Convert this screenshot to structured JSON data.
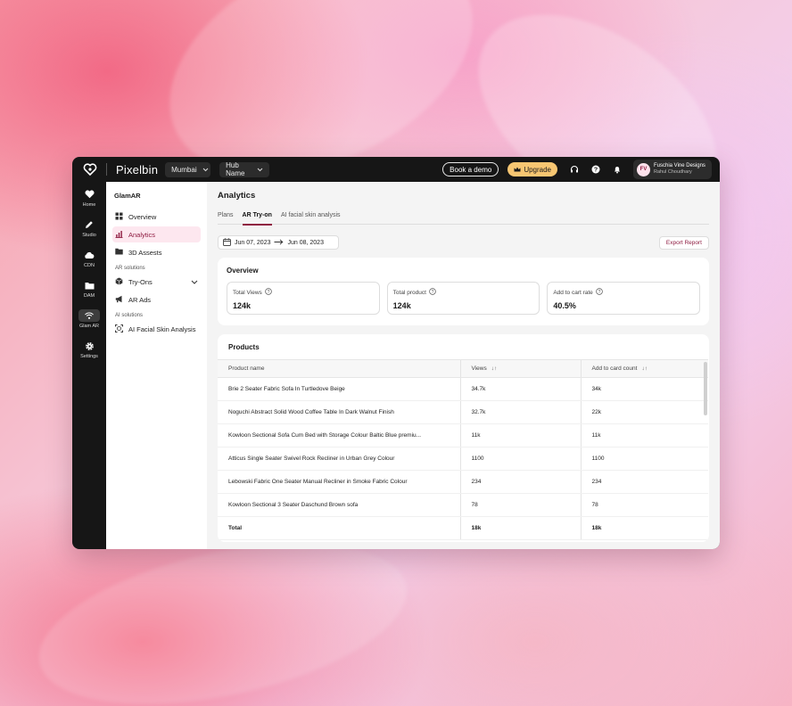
{
  "colors": {
    "accent": "#8e1b40",
    "upgrade": "#f7c672",
    "dark": "#161616"
  },
  "topbar": {
    "brand": "Pixelbin",
    "region": "Mumbai",
    "hub": "Hub Name",
    "book_demo": "Book a demo",
    "upgrade": "Upgrade",
    "account": {
      "initials": "FV",
      "org": "Fuschia Vine Designs",
      "user": "Rahul Choudhary"
    }
  },
  "rail": [
    {
      "label": "Home",
      "icon": "heart-icon"
    },
    {
      "label": "Studio",
      "icon": "pen-icon"
    },
    {
      "label": "CDN",
      "icon": "cloud-icon"
    },
    {
      "label": "DAM",
      "icon": "folder-icon"
    },
    {
      "label": "Glam AR",
      "icon": "ar-icon"
    },
    {
      "label": "Settings",
      "icon": "gear-icon"
    }
  ],
  "sidebar": {
    "title": "GlamAR",
    "items": [
      {
        "label": "Overview",
        "icon": "grid-icon"
      },
      {
        "label": "Analytics",
        "icon": "chart-icon"
      },
      {
        "label": "3D Assests",
        "icon": "folder-icon"
      }
    ],
    "ar_section": "AR solutions",
    "ar_items": [
      {
        "label": "Try-Ons",
        "icon": "cube-icon"
      },
      {
        "label": "AR Ads",
        "icon": "megaphone-icon"
      }
    ],
    "ai_section": "AI solutions",
    "ai_items": [
      {
        "label": "AI Facial Skin Analysis",
        "icon": "face-scan-icon"
      }
    ]
  },
  "main": {
    "title": "Analytics",
    "tabs": [
      "Plans",
      "AR Try-on",
      "AI facial skin analysis"
    ],
    "active_tab": "AR Try-on",
    "date_from": "Jun 07, 2023",
    "date_to": "Jun 08, 2023",
    "export_label": "Export Report",
    "overview": {
      "title": "Overview",
      "metrics": [
        {
          "label": "Total Views",
          "value": "124k"
        },
        {
          "label": "Total product",
          "value": "124k"
        },
        {
          "label": "Add to cart rate",
          "value": "40.5%"
        }
      ]
    },
    "products": {
      "title": "Products",
      "headers": [
        "Product name",
        "Views",
        "Add to card count"
      ],
      "rows": [
        [
          "Brie 2 Seater Fabric Sofa In Turtledove Beige",
          "34.7k",
          "34k"
        ],
        [
          "Noguchi Abstract Solid Wood Coffee Table In Dark Walnut Finish",
          "32.7k",
          "22k"
        ],
        [
          "Kowloon Sectional Sofa Cum Bed with Storage Colour Baltic Blue premiu...",
          "11k",
          "11k"
        ],
        [
          "Atticus Single Seater Swivel Rock Recliner in Urban Grey Colour",
          "1100",
          "1100"
        ],
        [
          "Lebowski Fabric One Seater Manual Recliner in Smoke Fabric Colour",
          "234",
          "234"
        ],
        [
          "Kowloon Sectional 3 Seater Daschund Brown sofa",
          "78",
          "78"
        ]
      ],
      "total": [
        "Total",
        "18k",
        "18k"
      ]
    }
  }
}
